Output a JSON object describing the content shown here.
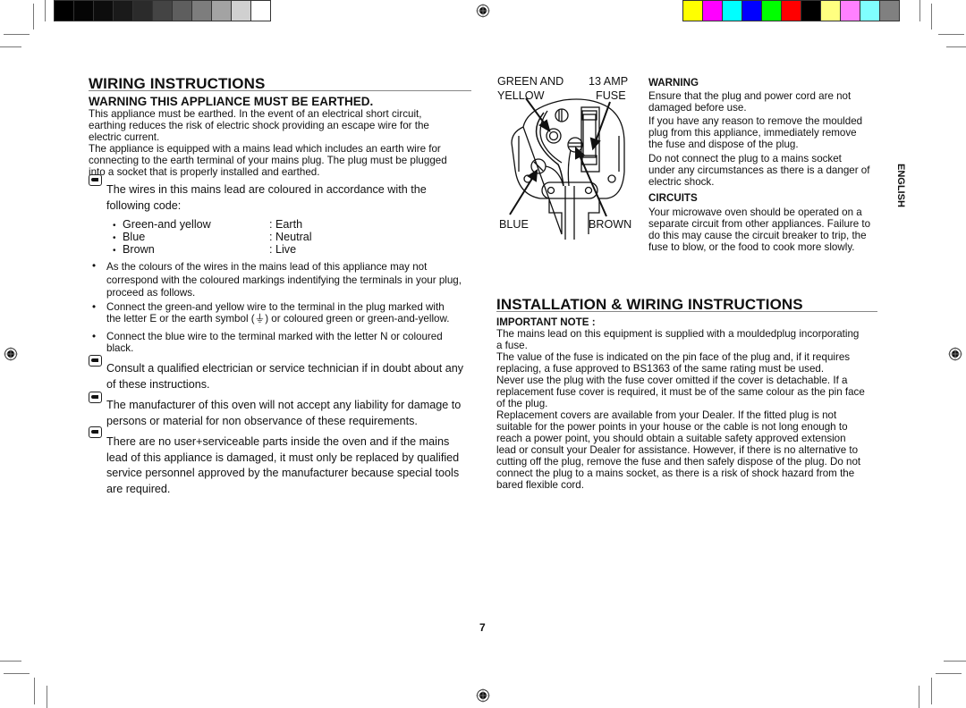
{
  "print_marks": {
    "grayscale_bar": [
      "#000000",
      "#050505",
      "#0d0d0d",
      "#1a1a1a",
      "#2b2b2b",
      "#444444",
      "#5e5e5e",
      "#7d7d7d",
      "#a3a3a3",
      "#d0d0d0",
      "#ffffff"
    ],
    "color_bar": [
      "#ffff00",
      "#ff00ff",
      "#00ffff",
      "#0000ff",
      "#00ff00",
      "#ff0000",
      "#000000",
      "#ffff80",
      "#ff80ff",
      "#80ffff",
      "#808080"
    ]
  },
  "left": {
    "title": "WIRING INSTRUCTIONS",
    "warning_heading": "WARNING THIS APPLIANCE MUST BE EARTHED.",
    "para1_lines": [
      "This appliance must be earthed. In the event of an electrical short circuit,",
      "earthing reduces the risk of electric shock providing an escape wire for the",
      "electric current."
    ],
    "para2_lines": [
      "The appliance is equipped with a mains lead which includes an earth wire for",
      "connecting to the earth terminal of your mains plug. The plug must be plugged",
      "into a socket that is properly installed and earthed."
    ],
    "note1_lines": [
      "The wires in this mains lead are coloured in accordance with the",
      "following code:"
    ],
    "colour_code": [
      {
        "wire": "Green-and yellow",
        "role": ": Earth"
      },
      {
        "wire": "Blue",
        "role": ": Neutral"
      },
      {
        "wire": "Brown",
        "role": ": Live"
      }
    ],
    "bullet_char": "•",
    "bullets": [
      {
        "lines": [
          "As the colours of the wires in the mains lead of this appliance may not",
          "correspond with the coloured markings indentifying the terminals in your plug,",
          "proceed as follows."
        ]
      },
      {
        "lines": [
          "Connect the green-and yellow wire to the terminal in the plug marked with",
          "the letter E or the earth symbol (⏚) or coloured green or green-and-yellow."
        ]
      },
      {
        "lines": [
          "Connect the blue wire to the terminal marked with the letter N or coloured",
          "black."
        ]
      }
    ],
    "notes": [
      {
        "lines": [
          "Consult a qualified electrician or service technician if in doubt about any",
          "of these instructions."
        ]
      },
      {
        "lines": [
          "The manufacturer of this oven will not accept any liability for damage to",
          "persons or material for non observance of these requirements."
        ]
      },
      {
        "lines": [
          "There are no user+serviceable parts inside the oven and if the mains",
          "lead of this appliance is damaged, it must only be replaced by qualified",
          "service personnel approved by the manufacturer because special tools",
          "are required."
        ]
      }
    ]
  },
  "diagram": {
    "label_green_yellow_1": "GREEN AND",
    "label_green_yellow_2": "YELLOW",
    "label_fuse_1": "13 AMP",
    "label_fuse_2": "FUSE",
    "label_blue": "BLUE",
    "label_brown": "BROWN"
  },
  "right": {
    "warning_heading": "WARNING",
    "warning_paras": [
      [
        "Ensure that the plug and power cord are not",
        "damaged before use."
      ],
      [
        "If you have any reason to remove the moulded",
        "plug from this appliance, immediately remove",
        "the fuse and dispose of the plug."
      ],
      [
        "Do not connect the plug to a mains socket",
        "under any circumstances as there is a danger of",
        "electric shock."
      ]
    ],
    "circuits_heading": "CIRCUITS",
    "circuits_lines": [
      "Your microwave oven should be operated on a",
      "separate circuit from other appliances. Failure to",
      "do this may cause the circuit breaker to trip, the",
      "fuse to blow, or the food to cook more slowly."
    ],
    "side_tab": "ENGLISH",
    "install_title": "INSTALLATION & WIRING INSTRUCTIONS",
    "important_heading": "IMPORTANT NOTE :",
    "install_lines": [
      "The mains lead on this equipment is supplied with a mouldedplug incorporating",
      "a fuse.",
      "The value of the fuse is indicated on the pin face of the plug and, if it requires",
      "replacing, a fuse approved to BS1363 of the same rating must be used.",
      "Never use the plug with the fuse cover omitted if the cover is detachable. If a",
      "replacement fuse cover is required, it must be of the same colour as the pin face",
      "of the plug.",
      "Replacement covers are available from your Dealer. If the fitted plug is not",
      "suitable for the power points in your house or the cable is not long enough to",
      "reach a power point, you should obtain a suitable safety approved extension",
      "lead or consult your Dealer for assistance. However, if there is no alternative to",
      "cutting off the plug, remove the fuse and then safely dispose of the plug. Do not",
      "connect the plug to a mains socket, as there is a risk of shock hazard from the",
      "bared flexible cord."
    ]
  },
  "page_number": "7"
}
